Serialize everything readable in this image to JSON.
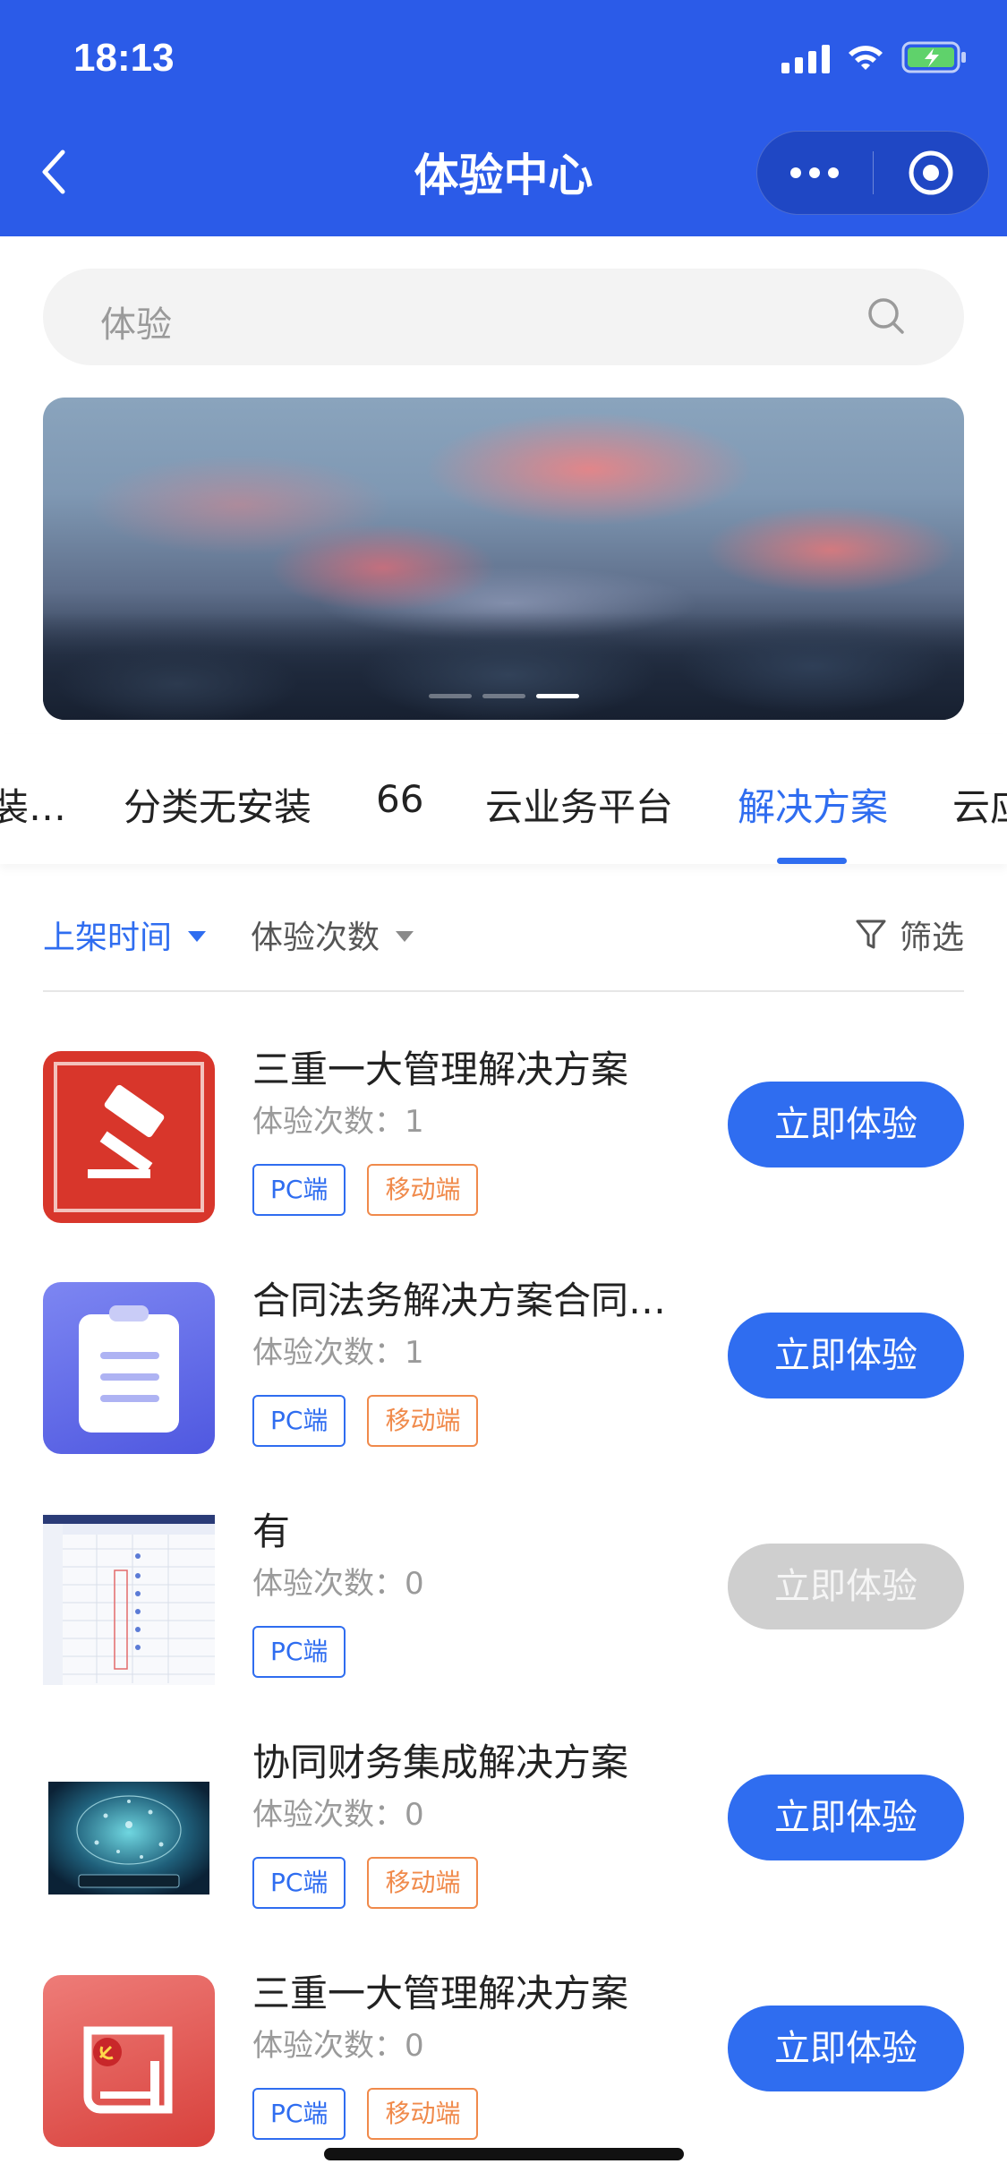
{
  "status_bar": {
    "time": "18:13"
  },
  "nav": {
    "title": "体验中心"
  },
  "search": {
    "placeholder": "体验"
  },
  "banner": {
    "indicator_count": 3,
    "active_index": 2
  },
  "tabs": [
    {
      "label": "装…"
    },
    {
      "label": "分类无安装"
    },
    {
      "label": "66"
    },
    {
      "label": "云业务平台"
    },
    {
      "label": "解决方案",
      "active": true
    },
    {
      "label": "云应"
    }
  ],
  "sort": {
    "publish_time": "上架时间",
    "experience_count": "体验次数",
    "filter": "筛选"
  },
  "colors": {
    "primary": "#2b5be8",
    "accent": "#2f6df0",
    "mobile_tag": "#f08a4b",
    "disabled": "#cfcfcf"
  },
  "items": [
    {
      "title": "三重一大管理解决方案",
      "count_label": "体验次数：",
      "count": "1",
      "tags": [
        "PC端",
        "移动端"
      ],
      "button": "立即体验",
      "enabled": true,
      "icon": "gavel-icon"
    },
    {
      "title": "合同法务解决方案合同…",
      "count_label": "体验次数：",
      "count": "1",
      "tags": [
        "PC端",
        "移动端"
      ],
      "button": "立即体验",
      "enabled": true,
      "icon": "clipboard-icon"
    },
    {
      "title": "有",
      "count_label": "体验次数：",
      "count": "0",
      "tags": [
        "PC端"
      ],
      "button": "立即体验",
      "enabled": false,
      "icon": "spreadsheet-thumbnail"
    },
    {
      "title": "协同财务集成解决方案",
      "count_label": "体验次数：",
      "count": "0",
      "tags": [
        "PC端",
        "移动端"
      ],
      "button": "立即体验",
      "enabled": true,
      "icon": "network-thumbnail"
    },
    {
      "title": "三重一大管理解决方案",
      "count_label": "体验次数：",
      "count": "0",
      "tags": [
        "PC端",
        "移动端"
      ],
      "button": "立即体验",
      "enabled": true,
      "icon": "party-book-icon"
    }
  ]
}
